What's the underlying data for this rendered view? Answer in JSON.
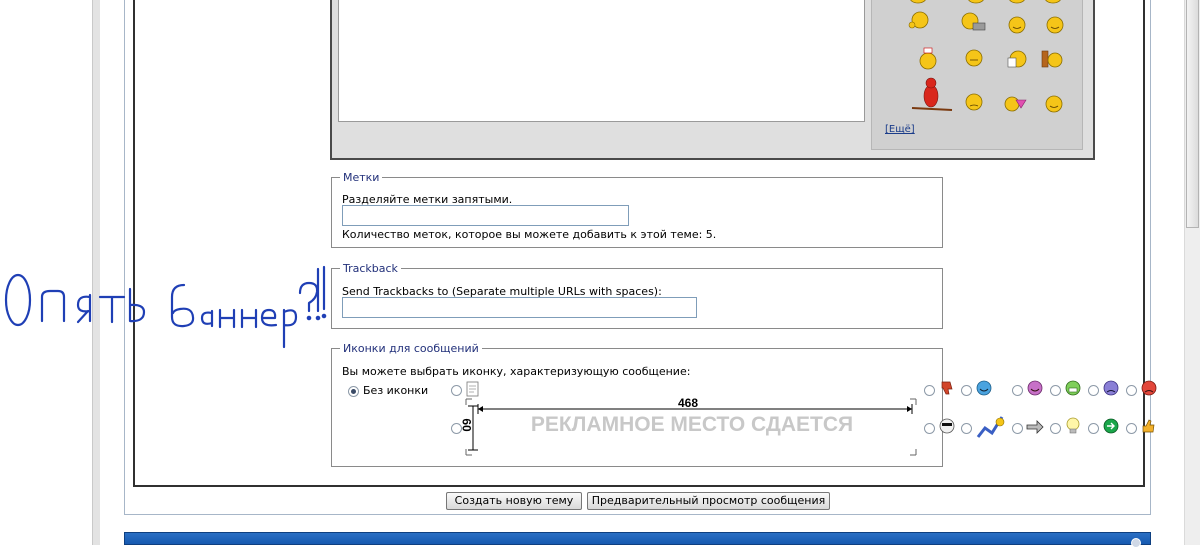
{
  "more_smilies_label": "[Ещё]",
  "tags": {
    "legend": "Метки",
    "hint": "Разделяйте метки запятыми.",
    "input_value": "",
    "count_text": "Количество меток, которое вы можете добавить к этой теме: 5."
  },
  "trackback": {
    "legend": "Trackback",
    "label": "Send Trackbacks to (Separate multiple URLs with spaces):",
    "input_value": ""
  },
  "icons": {
    "legend": "Иконки для сообщений",
    "hint": "Вы можете выбрать иконку, характеризующую сообщение:",
    "no_icon_label": "Без иконки",
    "selected": "no-icon"
  },
  "banner": {
    "text": "РЕКЛАМНОЕ МЕСТО СДАЕТСЯ",
    "width_label": "468",
    "height_label": "60"
  },
  "buttons": {
    "create_topic": "Создать новую тему",
    "preview": "Предварительный просмотр сообщения"
  },
  "annotation": {
    "text": "Опять баннер?!"
  },
  "colors": {
    "link": "#1a3c8a",
    "legend": "#22307a",
    "blue_bar": "#1659b0",
    "annotation_ink": "#1f3fb5"
  }
}
